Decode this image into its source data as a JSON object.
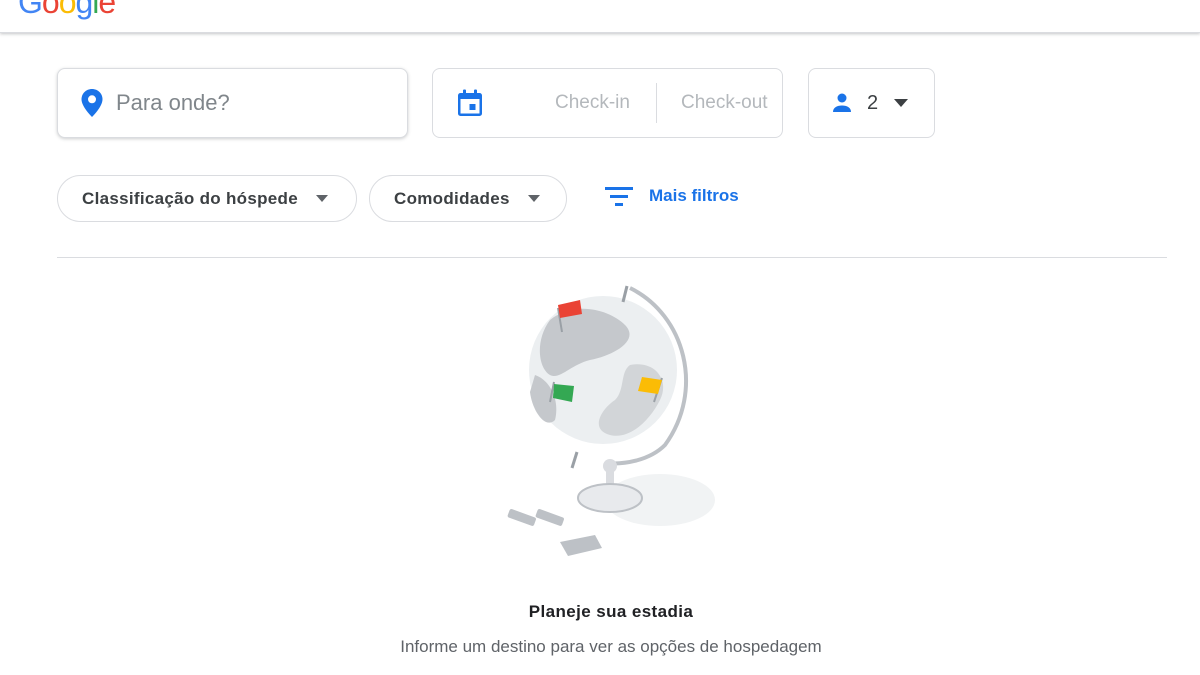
{
  "header": {
    "logo_text": "Google",
    "logo_colors": [
      "#4285F4",
      "#EA4335",
      "#FBBC05",
      "#4285F4",
      "#34A853",
      "#EA4335"
    ]
  },
  "search": {
    "placeholder": "Para onde?",
    "value": "",
    "icon": "location-pin-icon"
  },
  "dates": {
    "icon": "calendar-icon",
    "checkin_label": "Check-in",
    "checkout_label": "Check-out"
  },
  "guests": {
    "icon": "person-icon",
    "count": "2",
    "dropdown_icon": "caret-down-icon"
  },
  "filters": {
    "chips": [
      {
        "label": "Classificação do hóspede"
      },
      {
        "label": "Comodidades"
      }
    ],
    "more": {
      "label": "Mais filtros",
      "icon": "filter-list-icon"
    }
  },
  "empty_state": {
    "illustration": "globe-illustration",
    "title": "Planeje sua estadia",
    "subtitle": "Informe um destino para ver as opções de hospedagem"
  },
  "colors": {
    "accent": "#1a73e8",
    "border": "#dadce0",
    "text_muted": "#5f6368"
  }
}
